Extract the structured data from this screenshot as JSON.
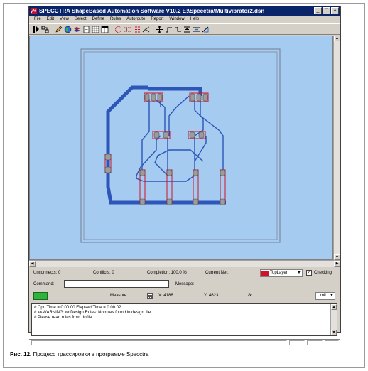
{
  "window": {
    "title": "SPECCTRA ShapeBased Automation Software V10.2 E:\\Specctra\\Multivibrator2.dsn",
    "controls": [
      "_",
      "□",
      "×"
    ]
  },
  "menu": [
    "File",
    "Edit",
    "View",
    "Select",
    "Define",
    "Rules",
    "Autoroute",
    "Report",
    "Window",
    "Help"
  ],
  "toolbar": {
    "icons": [
      "select-mode-icon",
      "place-mode-icon",
      "pencil-icon",
      "globe-icon",
      "layers-icon",
      "document-icon",
      "grid-icon",
      "window-icon",
      "ratsnest-icon",
      "guides-icon",
      "route-icon",
      "fanout-icon",
      "move-icon",
      "wire-icon",
      "bend-icon",
      "squeeze-icon",
      "shove-icon",
      "measure-icon"
    ]
  },
  "status": {
    "unconnects": "Unconnects: 0",
    "conflicts": "Conflicts: 0",
    "completion": "Completion: 100.0 %",
    "current_net": "Current Net:",
    "layer": "TopLayer",
    "layer_color": "#d2112a",
    "checking_label": "Checking",
    "checking_checked": true
  },
  "command": {
    "label": "Command:",
    "value": "",
    "message_label": "Message:"
  },
  "measure": {
    "label": "Measure",
    "x": "X: 4186",
    "y": "Y: 4623",
    "delta": "Δ:",
    "unit": "mil"
  },
  "console": {
    "lines": [
      "# Cpu Time = 0:00:00  Elapsed Time = 0:00:02",
      "# <<WARNING:>> Design Rules: No rules found in design file.",
      "# Please read rules from dofile."
    ]
  },
  "caption": {
    "bold": "Рис. 12.",
    "text": " Процесс трассировки в программе Specctra"
  },
  "colors": {
    "canvas": "#a6cbf0",
    "trace": "#2c56b8",
    "pad": "#9c9c9c",
    "component_outline": "#d2112a",
    "measure_led": "#2fb33b"
  }
}
